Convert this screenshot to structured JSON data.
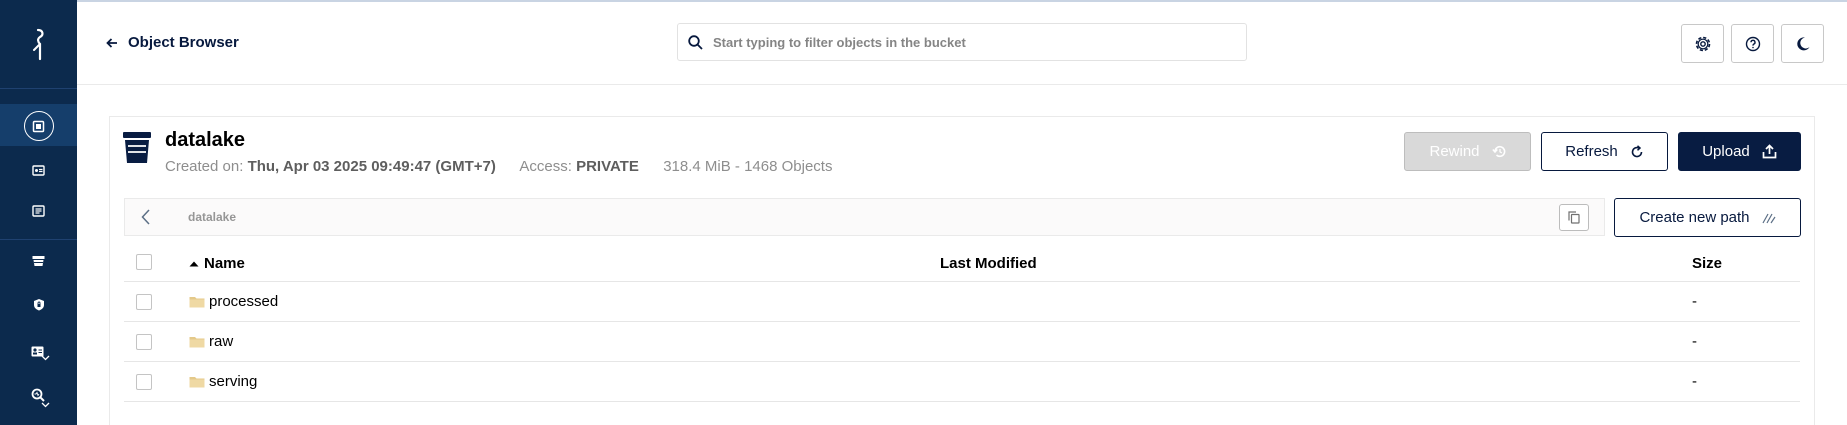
{
  "header": {
    "back_label": "Object Browser",
    "search_placeholder": "Start typing to filter objects in the bucket"
  },
  "bucket": {
    "name": "datalake",
    "created_label": "Created on:",
    "created_value": "Thu, Apr 03 2025 09:49:47 (GMT+7)",
    "access_label": "Access:",
    "access_value": "PRIVATE",
    "usage": "318.4 MiB - 1468 Objects"
  },
  "actions": {
    "rewind": "Rewind",
    "refresh": "Refresh",
    "upload": "Upload"
  },
  "breadcrumb": {
    "path": "datalake",
    "create_new_path": "Create new path"
  },
  "table": {
    "columns": {
      "name": "Name",
      "last_modified": "Last Modified",
      "size": "Size"
    },
    "rows": [
      {
        "name": "processed",
        "last_modified": "",
        "size": "-"
      },
      {
        "name": "raw",
        "last_modified": "",
        "size": "-"
      },
      {
        "name": "serving",
        "last_modified": "",
        "size": "-"
      }
    ]
  },
  "colors": {
    "sidebar": "#0c2a4d",
    "primary": "#081c42",
    "folder": "#e4c98a"
  },
  "icons": {
    "sidebar": [
      "minio-logo-icon",
      "object-browser-icon",
      "access-keys-icon",
      "documentation-icon",
      "buckets-icon",
      "policies-icon",
      "identity-icon",
      "monitoring-icon"
    ],
    "header": [
      "back-arrow-icon",
      "search-icon",
      "settings-icon",
      "help-icon",
      "dark-mode-icon"
    ]
  }
}
